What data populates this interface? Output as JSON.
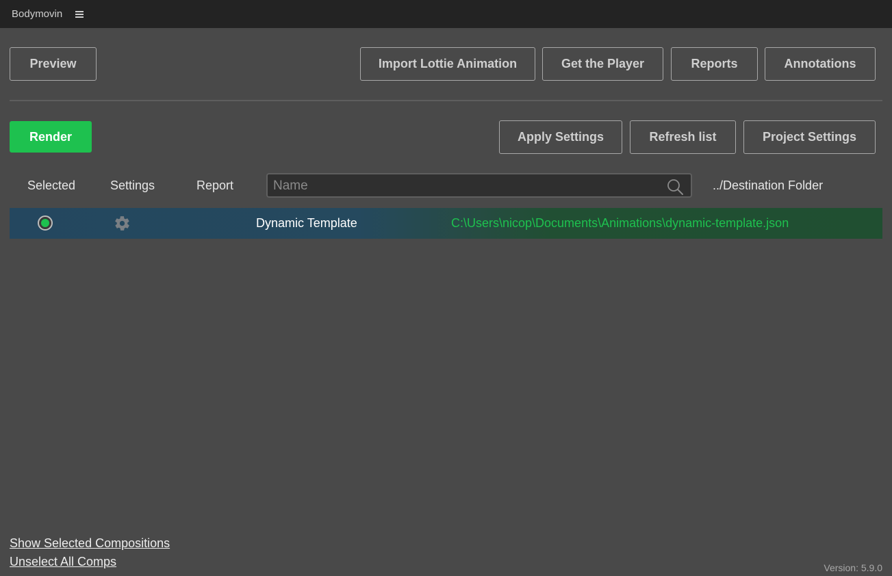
{
  "app": {
    "title": "Bodymovin",
    "menu_icon": "hamburger-menu-icon"
  },
  "toolbar_top": {
    "preview": "Preview",
    "import_lottie": "Import Lottie Animation",
    "get_player": "Get the Player",
    "reports": "Reports",
    "annotations": "Annotations"
  },
  "toolbar_actions": {
    "render": "Render",
    "apply_settings": "Apply Settings",
    "refresh_list": "Refresh list",
    "project_settings": "Project Settings"
  },
  "columns": {
    "selected": "Selected",
    "settings": "Settings",
    "report": "Report",
    "destination": "../Destination Folder"
  },
  "search": {
    "placeholder": "Name",
    "value": "",
    "icon": "search-icon"
  },
  "compositions": [
    {
      "selected": true,
      "name": "Dynamic Template",
      "destination": "C:\\Users\\nicop\\Documents\\Animations\\dynamic-template.json",
      "settings_icon": "gear-icon"
    }
  ],
  "footer": {
    "show_selected": "Show Selected Compositions",
    "unselect_all": "Unselect All Comps",
    "version": "Version: 5.9.0"
  },
  "colors": {
    "background": "#494949",
    "titlebar": "#232323",
    "accent_green": "#1ec14f",
    "row_selected": "#24475f"
  }
}
